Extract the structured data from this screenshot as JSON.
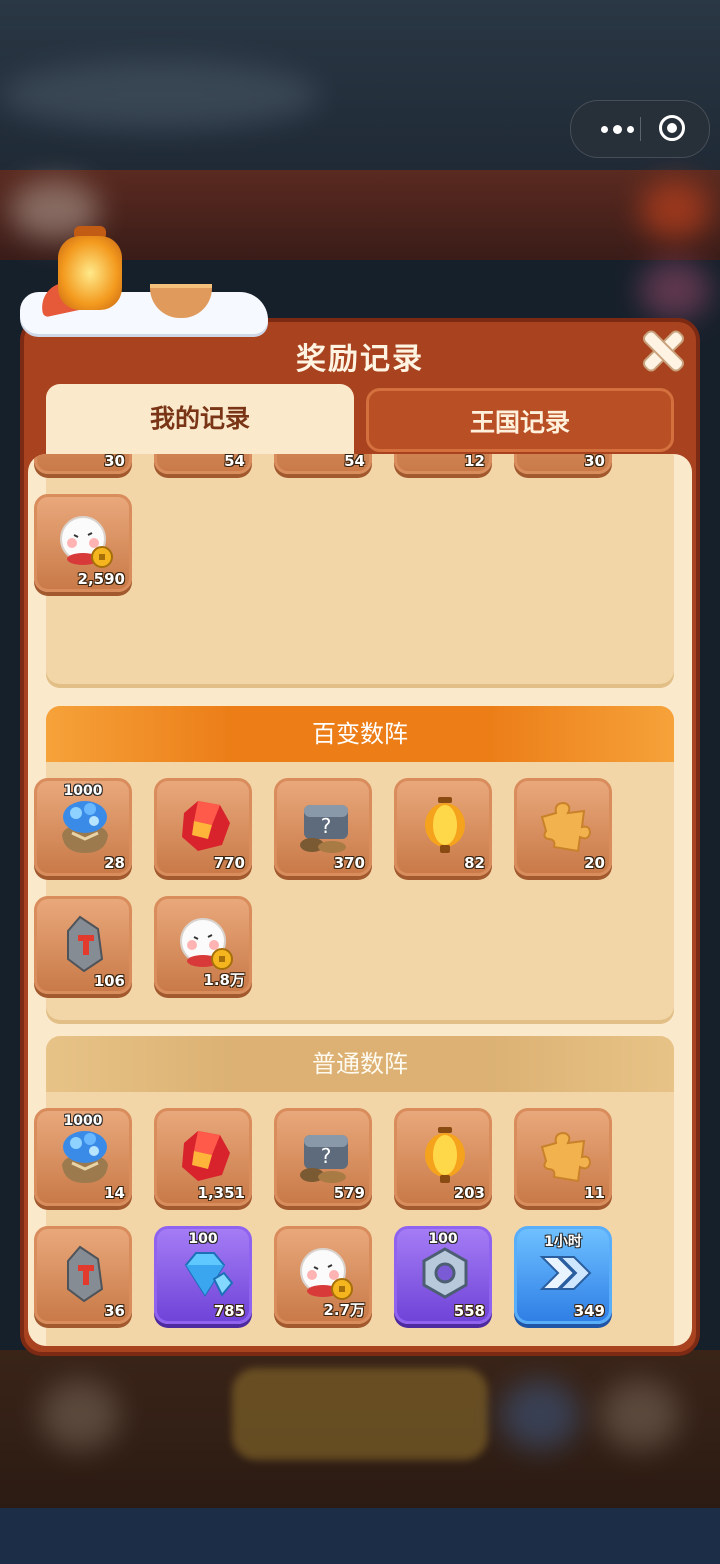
{
  "dialog": {
    "title": "奖励记录"
  },
  "tabs": [
    {
      "label": "我的记录",
      "active": true
    },
    {
      "label": "王国记录",
      "active": false
    }
  ],
  "sections": [
    {
      "title": "",
      "items": [
        {
          "icon": "gem-bag-icon",
          "count": "30"
        },
        {
          "icon": "red-crystal-icon",
          "count": "54"
        },
        {
          "icon": "treasure-chest-icon",
          "count": "54"
        },
        {
          "icon": "puzzle-piece-icon",
          "count": "12"
        },
        {
          "icon": "rune-stone-icon",
          "count": "30"
        },
        {
          "icon": "coin-mascot-icon",
          "count": "2,590"
        }
      ]
    },
    {
      "title": "百变数阵",
      "items": [
        {
          "icon": "gem-bag-icon",
          "tag": "1000",
          "count": "28"
        },
        {
          "icon": "red-crystal-icon",
          "count": "770"
        },
        {
          "icon": "treasure-chest-icon",
          "count": "370"
        },
        {
          "icon": "lantern-icon",
          "count": "82"
        },
        {
          "icon": "puzzle-piece-icon",
          "count": "20"
        },
        {
          "icon": "rune-stone-icon",
          "count": "106"
        },
        {
          "icon": "coin-mascot-icon",
          "count": "1.8万"
        }
      ]
    },
    {
      "title": "普通数阵",
      "items": [
        {
          "icon": "gem-bag-icon",
          "tag": "1000",
          "count": "14"
        },
        {
          "icon": "red-crystal-icon",
          "count": "1,351"
        },
        {
          "icon": "treasure-chest-icon",
          "count": "579"
        },
        {
          "icon": "lantern-icon",
          "count": "203"
        },
        {
          "icon": "puzzle-piece-icon",
          "count": "11"
        },
        {
          "icon": "rune-stone-icon",
          "count": "36"
        },
        {
          "icon": "diamond-icon",
          "tag": "100",
          "count": "785"
        },
        {
          "icon": "coin-mascot-icon",
          "count": "2.7万"
        },
        {
          "icon": "hex-nut-icon",
          "tag": "100",
          "count": "558"
        },
        {
          "icon": "speed-up-icon",
          "tag": "1小时",
          "count": "349"
        }
      ]
    }
  ]
}
